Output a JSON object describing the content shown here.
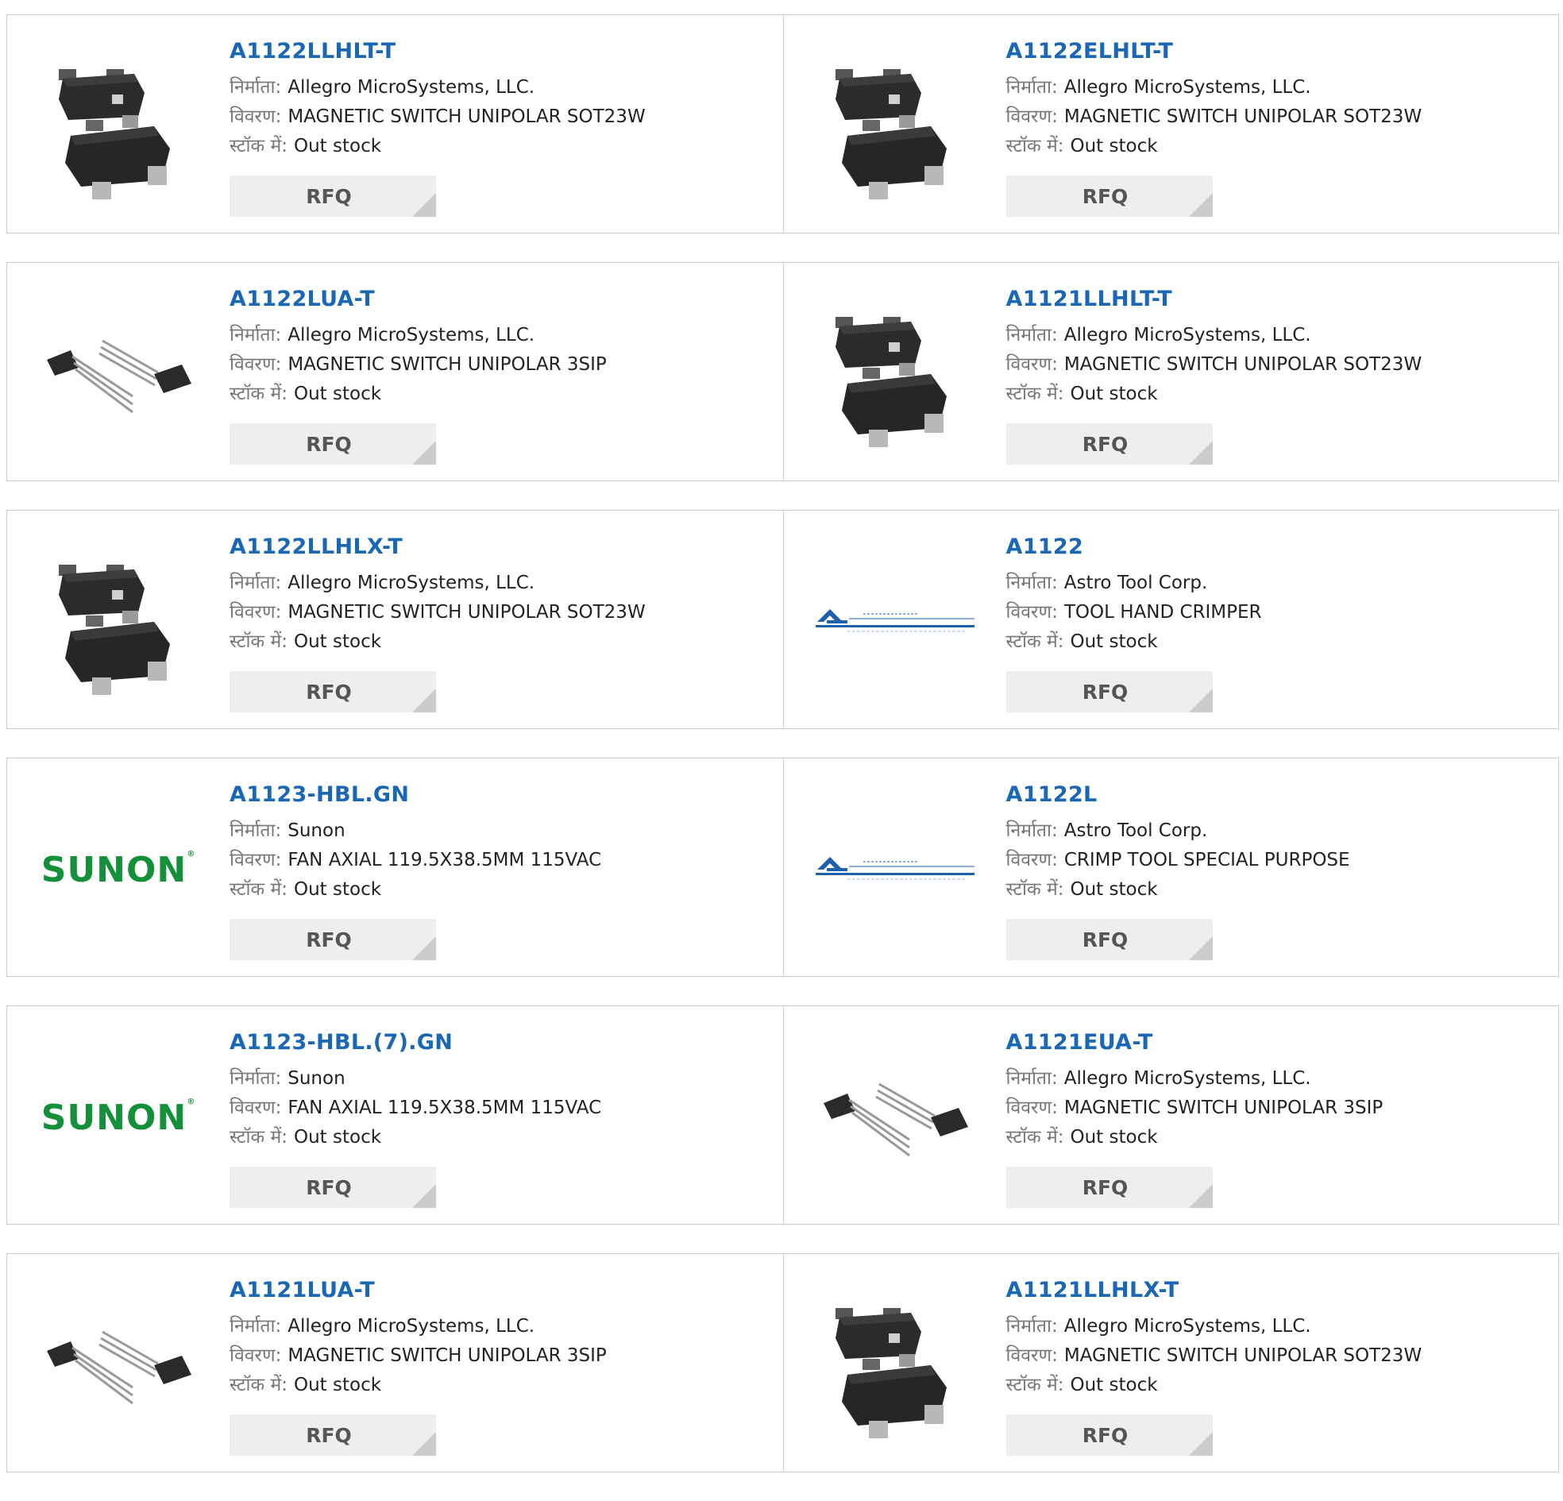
{
  "labels": {
    "manufacturer": "निर्माता:",
    "description": "विवरण:",
    "stock": "स्टॉक में:",
    "rfq": "RFQ"
  },
  "colors": {
    "link": "#1a67b5",
    "sunon_green": "#14903a",
    "astro_blue": "#1f5fb0"
  },
  "products": [
    {
      "pn": "A1122LLHLT-T",
      "mfr": "Allegro MicroSystems, LLC.",
      "desc": "MAGNETIC SWITCH UNIPOLAR SOT23W",
      "stock": "Out stock",
      "image": "sot23-chip"
    },
    {
      "pn": "A1122ELHLT-T",
      "mfr": "Allegro MicroSystems, LLC.",
      "desc": "MAGNETIC SWITCH UNIPOLAR SOT23W",
      "stock": "Out stock",
      "image": "sot23-chip"
    },
    {
      "pn": "A1122LUA-T",
      "mfr": "Allegro MicroSystems, LLC.",
      "desc": "MAGNETIC SWITCH UNIPOLAR 3SIP",
      "stock": "Out stock",
      "image": "sip3-chip"
    },
    {
      "pn": "A1121LLHLT-T",
      "mfr": "Allegro MicroSystems, LLC.",
      "desc": "MAGNETIC SWITCH UNIPOLAR SOT23W",
      "stock": "Out stock",
      "image": "sot23-chip"
    },
    {
      "pn": "A1122LLHLX-T",
      "mfr": "Allegro MicroSystems, LLC.",
      "desc": "MAGNETIC SWITCH UNIPOLAR SOT23W",
      "stock": "Out stock",
      "image": "sot23-chip"
    },
    {
      "pn": "A1122",
      "mfr": "Astro Tool Corp.",
      "desc": "TOOL HAND CRIMPER",
      "stock": "Out stock",
      "image": "astro-logo"
    },
    {
      "pn": "A1123-HBL.GN",
      "mfr": "Sunon",
      "desc": "FAN AXIAL 119.5X38.5MM 115VAC",
      "stock": "Out stock",
      "image": "sunon-logo"
    },
    {
      "pn": "A1122L",
      "mfr": "Astro Tool Corp.",
      "desc": "CRIMP TOOL SPECIAL PURPOSE",
      "stock": "Out stock",
      "image": "astro-logo"
    },
    {
      "pn": "A1123-HBL.(7).GN",
      "mfr": "Sunon",
      "desc": "FAN AXIAL 119.5X38.5MM 115VAC",
      "stock": "Out stock",
      "image": "sunon-logo"
    },
    {
      "pn": "A1121EUA-T",
      "mfr": "Allegro MicroSystems, LLC.",
      "desc": "MAGNETIC SWITCH UNIPOLAR 3SIP",
      "stock": "Out stock",
      "image": "sip3-chip"
    },
    {
      "pn": "A1121LUA-T",
      "mfr": "Allegro MicroSystems, LLC.",
      "desc": "MAGNETIC SWITCH UNIPOLAR 3SIP",
      "stock": "Out stock",
      "image": "sip3-chip"
    },
    {
      "pn": "A1121LLHLX-T",
      "mfr": "Allegro MicroSystems, LLC.",
      "desc": "MAGNETIC SWITCH UNIPOLAR SOT23W",
      "stock": "Out stock",
      "image": "sot23-chip"
    }
  ]
}
